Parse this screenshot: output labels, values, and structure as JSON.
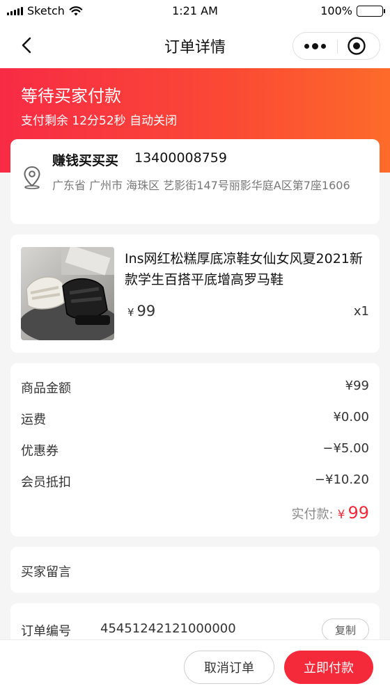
{
  "status_bar": {
    "carrier": "Sketch",
    "time": "1:21 AM",
    "battery": "100%"
  },
  "nav": {
    "title": "订单详情",
    "icons": [
      "back-icon",
      "more-icon",
      "target-icon"
    ]
  },
  "banner": {
    "status": "等待买家付款",
    "countdown": "支付剩余 12分52秒 自动关闭"
  },
  "address": {
    "name": "赚钱买买买",
    "phone": "13400008759",
    "detail": "广东省 广州市 海珠区 艺影街147号丽影华庭A区第7座1606"
  },
  "product": {
    "name": "Ins网红松糕厚底凉鞋女仙女风夏2021新款学生百搭平底增高罗马鞋",
    "currency": "¥",
    "price": "99",
    "quantity": "x1"
  },
  "summary": {
    "rows": [
      {
        "label": "商品金额",
        "value": "¥99"
      },
      {
        "label": "运费",
        "value": "¥0.00"
      },
      {
        "label": "优惠券",
        "value": "−¥5.00"
      },
      {
        "label": "会员抵扣",
        "value": "−¥10.20"
      }
    ],
    "paid_label": "实付款:",
    "paid_currency": "¥",
    "paid_value": "99"
  },
  "remark": {
    "label": "买家留言"
  },
  "order": {
    "label": "订单编号",
    "number": "45451242121000000",
    "copy_label": "复制"
  },
  "actions": {
    "cancel_label": "取消订单",
    "pay_label": "立即付款"
  },
  "colors": {
    "accent": "#f42a3a",
    "banner_start": "#f72b45",
    "banner_end": "#fd6b2a"
  }
}
